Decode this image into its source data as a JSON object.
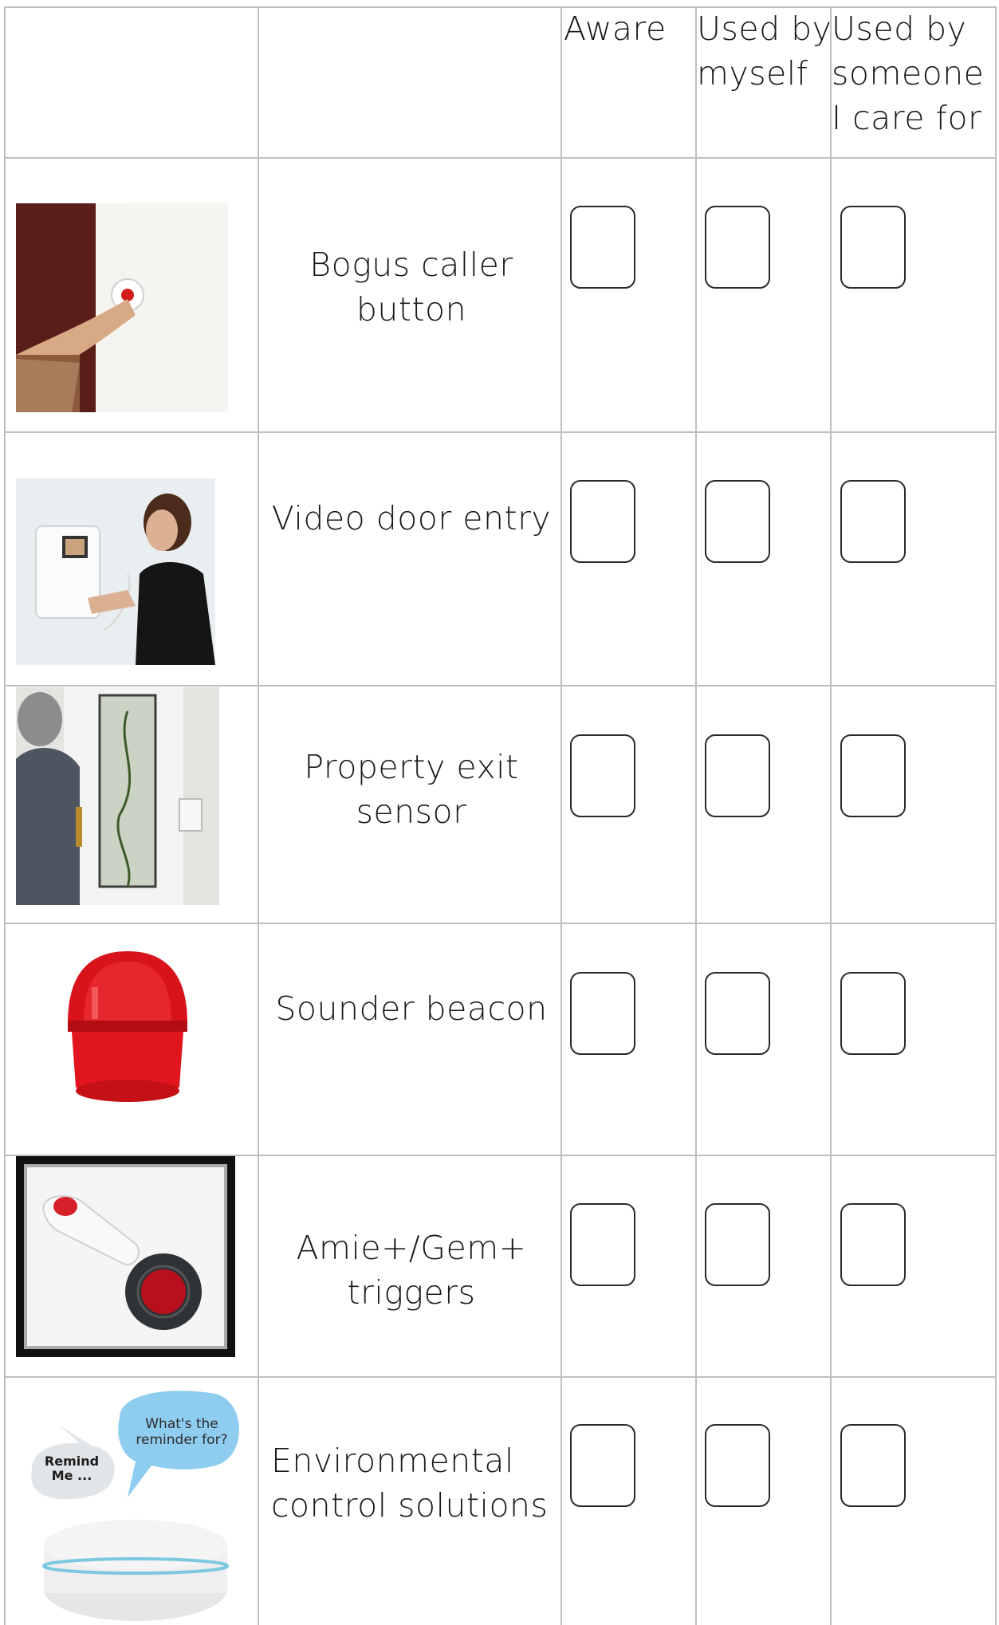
{
  "header": {
    "col_aware": "Aware",
    "col_myself": "Used by myself",
    "col_cared": "Used by someone I care for"
  },
  "rows": [
    {
      "label": "Bogus caller button",
      "image": "bogus-caller-button-photo"
    },
    {
      "label": "Video door entry",
      "image": "video-door-entry-photo"
    },
    {
      "label": "Property exit sensor",
      "image": "property-exit-sensor-photo"
    },
    {
      "label": "Sounder beacon",
      "image": "sounder-beacon-photo"
    },
    {
      "label": "Amie+/Gem+ triggers",
      "image": "amie-gem-triggers-photo"
    },
    {
      "label": "Environmental control solutions",
      "image": "environmental-control-photo"
    }
  ],
  "speech": {
    "remind": "Remind Me ...",
    "question": "What's the reminder for?"
  },
  "colors": {
    "grid": "#bfbfbf",
    "checkbox_border": "#2a2a2a",
    "beacon_red": "#d8131b",
    "bubble_grey": "#e2e5e8",
    "bubble_blue": "#8fcdf0"
  }
}
